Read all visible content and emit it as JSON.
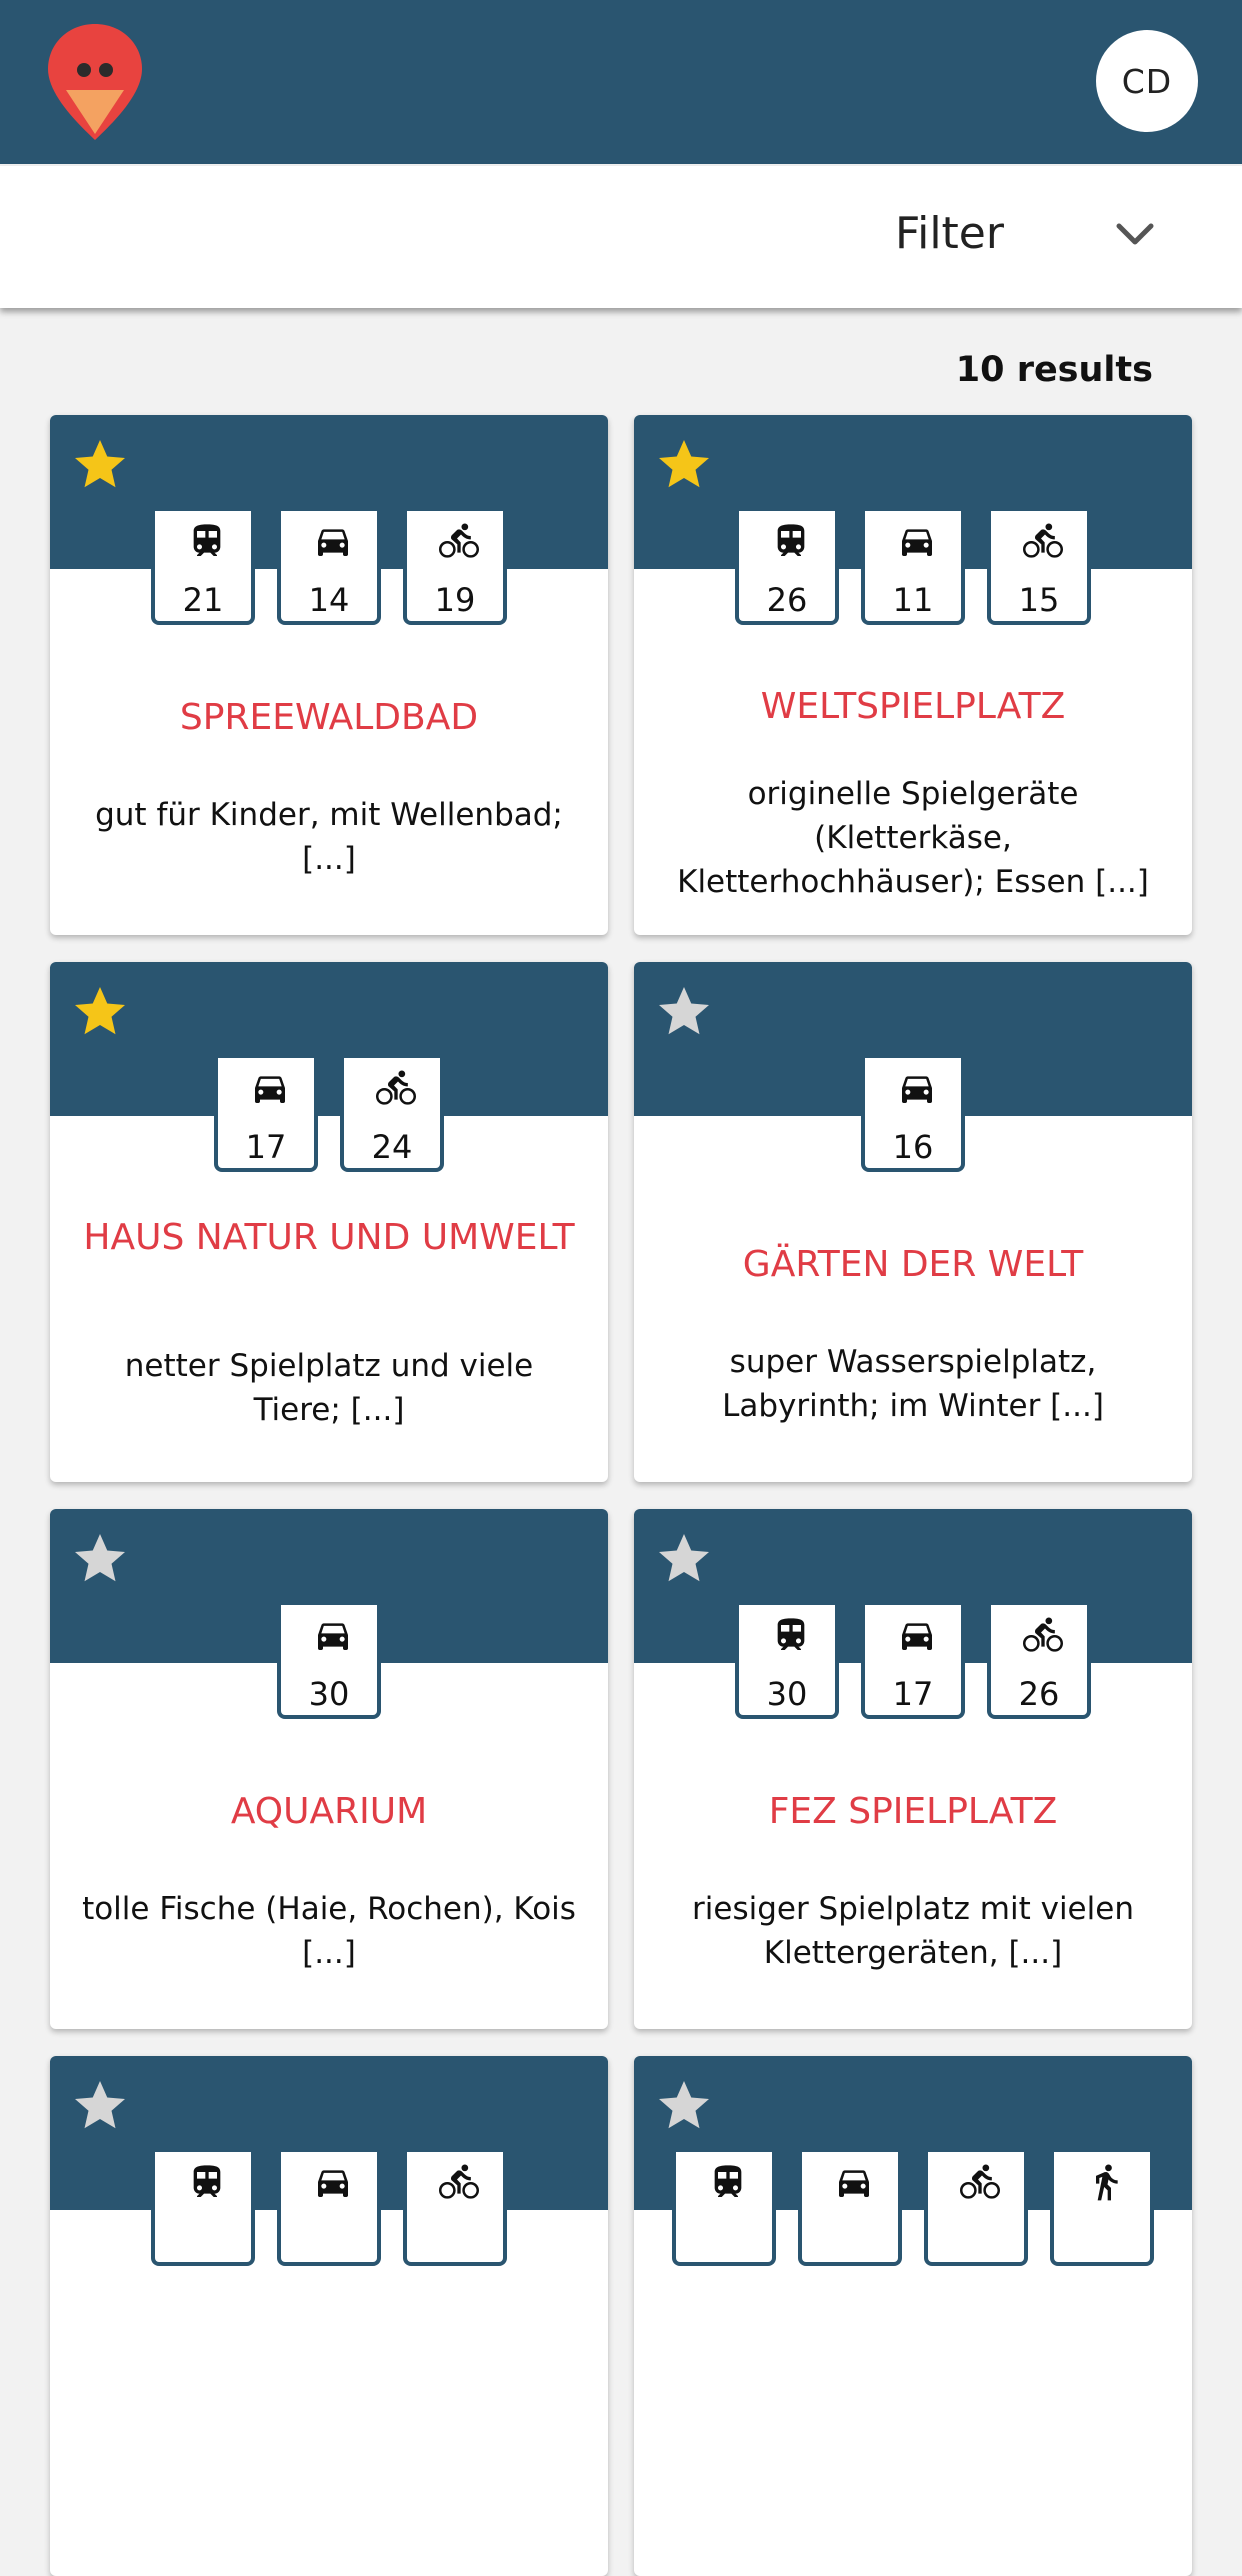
{
  "header": {
    "avatar_initials": "CD"
  },
  "filter": {
    "label": "Filter"
  },
  "results": {
    "count_label": "10 results"
  },
  "colors": {
    "header_bg": "#2a5570",
    "accent_red": "#e03c45",
    "star_active": "#f5c518",
    "star_inactive": "#d6d6d6"
  },
  "cards": [
    {
      "title": "SPREEWALDBAD",
      "desc": "gut für Kinder, mit Wellenbad; [...]",
      "favorite": true,
      "travel": [
        {
          "icon": "train-icon",
          "value": "21"
        },
        {
          "icon": "car-icon",
          "value": "14"
        },
        {
          "icon": "bike-icon",
          "value": "19"
        }
      ]
    },
    {
      "title": "WELTSPIELPLATZ",
      "desc": "originelle Spielgeräte (Kletterkäse, Kletterhochhäuser); Essen [...]",
      "favorite": true,
      "travel": [
        {
          "icon": "train-icon",
          "value": "26"
        },
        {
          "icon": "car-icon",
          "value": "11"
        },
        {
          "icon": "bike-icon",
          "value": "15"
        }
      ]
    },
    {
      "title": "HAUS NATUR UND UMWELT",
      "desc": "netter Spielplatz und viele Tiere; [...]",
      "favorite": true,
      "travel": [
        {
          "icon": "car-icon",
          "value": "17"
        },
        {
          "icon": "bike-icon",
          "value": "24"
        }
      ]
    },
    {
      "title": "GÄRTEN DER WELT",
      "desc": "super Wasserspielplatz, Labyrinth; im Winter [...]",
      "favorite": false,
      "travel": [
        {
          "icon": "car-icon",
          "value": "16"
        }
      ]
    },
    {
      "title": "AQUARIUM",
      "desc": "tolle Fische (Haie, Rochen), Kois [...]",
      "favorite": false,
      "travel": [
        {
          "icon": "car-icon",
          "value": "30"
        }
      ]
    },
    {
      "title": "FEZ SPIELPLATZ",
      "desc": "riesiger Spielplatz mit vielen Klettergeräten, [...]",
      "favorite": false,
      "travel": [
        {
          "icon": "train-icon",
          "value": "30"
        },
        {
          "icon": "car-icon",
          "value": "17"
        },
        {
          "icon": "bike-icon",
          "value": "26"
        }
      ]
    },
    {
      "title": "",
      "desc": "",
      "favorite": false,
      "travel": [
        {
          "icon": "train-icon",
          "value": ""
        },
        {
          "icon": "car-icon",
          "value": ""
        },
        {
          "icon": "bike-icon",
          "value": ""
        }
      ]
    },
    {
      "title": "",
      "desc": "",
      "favorite": false,
      "travel": [
        {
          "icon": "train-icon",
          "value": ""
        },
        {
          "icon": "car-icon",
          "value": ""
        },
        {
          "icon": "bike-icon",
          "value": ""
        },
        {
          "icon": "walk-icon",
          "value": ""
        }
      ]
    }
  ]
}
